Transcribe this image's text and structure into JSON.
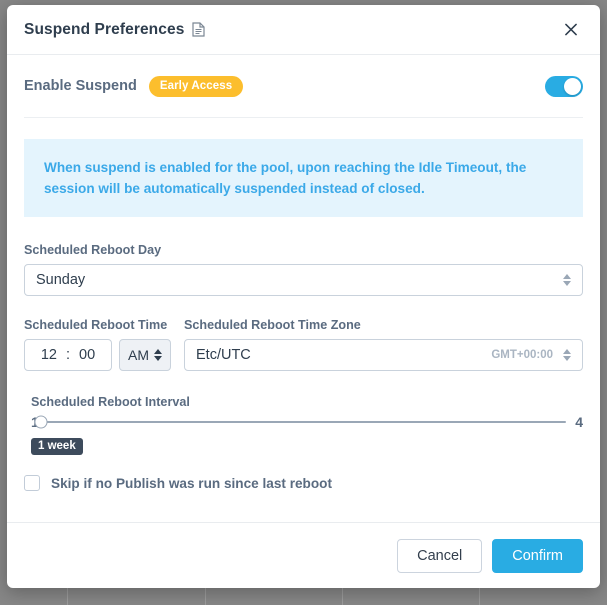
{
  "modal": {
    "title": "Suspend Preferences",
    "title_icon": "document-icon",
    "close_icon": "close-icon",
    "accent_color": "#29ace3",
    "badge_color": "#fcbe2d",
    "banner_bg": "#e4f4fd"
  },
  "enable_suspend": {
    "label": "Enable Suspend",
    "badge": "Early Access",
    "toggle_on": true
  },
  "banner": {
    "text": "When suspend is enabled for the pool, upon reaching the Idle Timeout, the session will be automatically suspended instead of closed."
  },
  "reboot_day": {
    "label": "Scheduled Reboot Day",
    "value": "Sunday"
  },
  "reboot_time": {
    "label": "Scheduled Reboot Time",
    "hours": "12",
    "separator": ":",
    "minutes": "00",
    "meridiem": "AM"
  },
  "reboot_timezone": {
    "label": "Scheduled Reboot Time Zone",
    "value": "Etc/UTC",
    "offset": "GMT+00:00"
  },
  "reboot_interval": {
    "label": "Scheduled Reboot Interval",
    "min": "1",
    "max": "4",
    "value": 1,
    "tooltip": "1 week"
  },
  "skip_publish": {
    "label": "Skip if no Publish was run since last reboot",
    "checked": false
  },
  "footer": {
    "cancel_label": "Cancel",
    "confirm_label": "Confirm"
  }
}
